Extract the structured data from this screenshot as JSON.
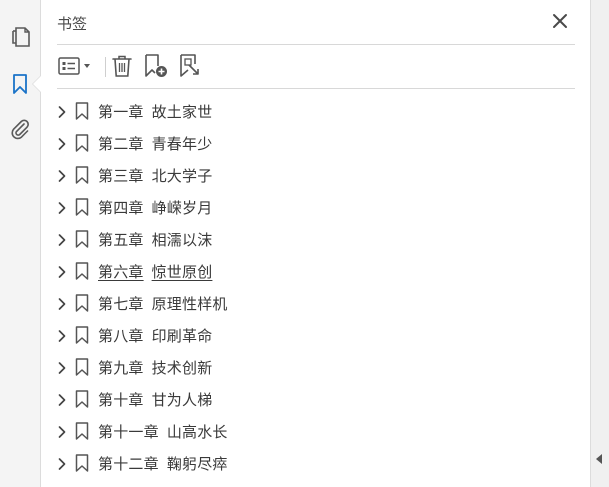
{
  "panel": {
    "title": "书签"
  },
  "rail": {
    "items": [
      {
        "name": "pages-icon"
      },
      {
        "name": "bookmarks-icon",
        "active": true
      },
      {
        "name": "attachments-icon"
      }
    ],
    "accent_color": "#1a73c8"
  },
  "toolbar": {
    "buttons": [
      {
        "name": "options-menu-icon"
      },
      {
        "name": "delete-bookmark-icon"
      },
      {
        "name": "new-bookmark-icon"
      },
      {
        "name": "new-bookmark-from-structure-icon"
      }
    ]
  },
  "bookmarks": [
    {
      "chapter": "第一章",
      "title": "故土家世"
    },
    {
      "chapter": "第二章",
      "title": "青春年少"
    },
    {
      "chapter": "第三章",
      "title": "北大学子"
    },
    {
      "chapter": "第四章",
      "title": "峥嵘岁月"
    },
    {
      "chapter": "第五章",
      "title": "相濡以沫"
    },
    {
      "chapter": "第六章",
      "title": "惊世原创",
      "underlined": true
    },
    {
      "chapter": "第七章",
      "title": "原理性样机"
    },
    {
      "chapter": "第八章",
      "title": "印刷革命"
    },
    {
      "chapter": "第九章",
      "title": "技术创新"
    },
    {
      "chapter": "第十章",
      "title": "甘为人梯"
    },
    {
      "chapter": "第十一章",
      "title": "山高水长"
    },
    {
      "chapter": "第十二章",
      "title": "鞠躬尽瘁"
    }
  ]
}
